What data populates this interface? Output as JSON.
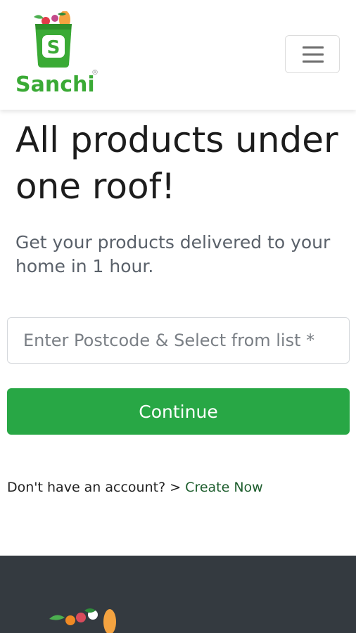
{
  "brand": {
    "name": "Sanchi",
    "badge_letter": "S",
    "mark": "®",
    "color": "#3aaa35"
  },
  "nav": {
    "menu_icon": "hamburger-menu-icon"
  },
  "hero": {
    "title": "All products under one roof!",
    "subtitle": "Get your products delivered to your home in 1 hour."
  },
  "form": {
    "postcode_placeholder": "Enter Postcode & Select from list *",
    "continue_label": "Continue"
  },
  "account": {
    "prompt": "Don't have an account? > ",
    "link_label": "Create Now"
  },
  "colors": {
    "primary": "#28a745",
    "footer_bg": "#343a40"
  }
}
